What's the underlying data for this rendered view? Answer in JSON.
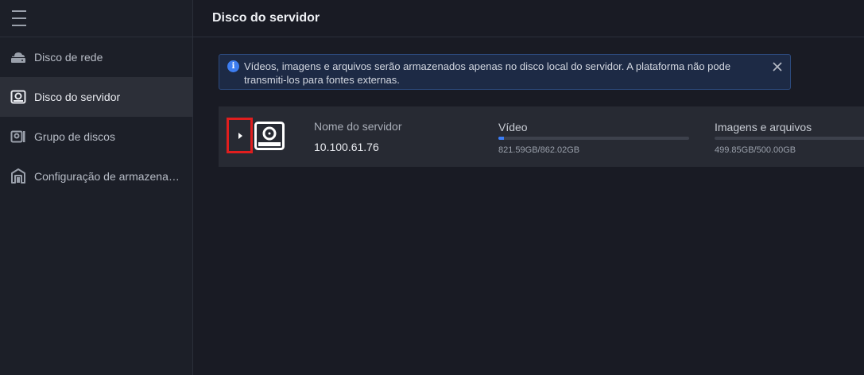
{
  "sidebar": {
    "items": [
      {
        "label": "Disco de rede",
        "icon": "network-disk-icon"
      },
      {
        "label": "Disco do servidor",
        "icon": "server-disk-icon",
        "active": true
      },
      {
        "label": "Grupo de discos",
        "icon": "disk-group-icon"
      },
      {
        "label": "Configuração de armazenam...",
        "icon": "storage-config-icon"
      }
    ]
  },
  "header": {
    "title": "Disco do servidor"
  },
  "banner": {
    "text": "Vídeos, imagens e arquivos serão armazenados apenas no disco local do servidor. A plataforma não pode transmiti-los para fontes externas.",
    "icon": "info-icon",
    "color": "#3d7df0"
  },
  "server": {
    "name_label": "Nome do servidor",
    "ip": "10.100.61.76",
    "video": {
      "label": "Vídeo",
      "values": "821.59GB/862.02GB",
      "fill": 0.03
    },
    "images": {
      "label": "Imagens e arquivos",
      "values": "499.85GB/500.00GB",
      "fill": 0.0
    }
  },
  "colors": {
    "accent": "#3c7df5",
    "highlight": "#e01e1e"
  }
}
